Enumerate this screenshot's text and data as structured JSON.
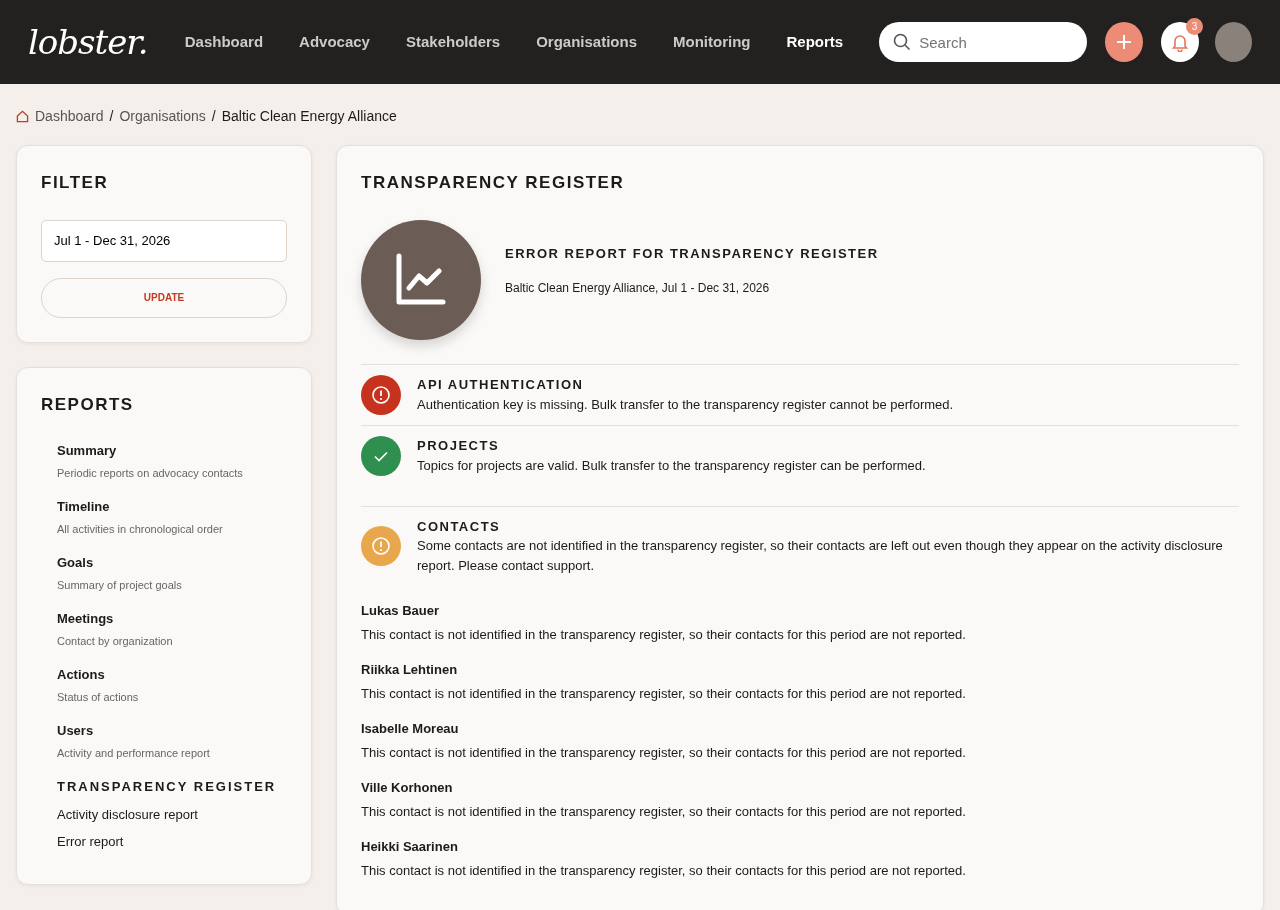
{
  "brand": "lobster.",
  "nav": [
    {
      "label": "Dashboard",
      "selected": false
    },
    {
      "label": "Advocacy",
      "selected": false
    },
    {
      "label": "Stakeholders",
      "selected": false
    },
    {
      "label": "Organisations",
      "selected": false
    },
    {
      "label": "Monitoring",
      "selected": false
    },
    {
      "label": "Reports",
      "selected": true
    }
  ],
  "search": {
    "placeholder": "Search"
  },
  "notifications": {
    "count": "3"
  },
  "breadcrumb": [
    "Dashboard",
    "Organisations",
    "Baltic Clean Energy Alliance"
  ],
  "breadcrumb_separator": "/",
  "filter": {
    "title": "FILTER",
    "date_range": "Jul 1 - Dec 31, 2026",
    "button": "UPDATE"
  },
  "reports": {
    "title": "REPORTS",
    "items": [
      {
        "title": "Summary",
        "subtitle": "Periodic reports on advocacy contacts"
      },
      {
        "title": "Timeline",
        "subtitle": "All activities in chronological order"
      },
      {
        "title": "Goals",
        "subtitle": "Summary of project goals"
      },
      {
        "title": "Meetings",
        "subtitle": "Contact by organization"
      },
      {
        "title": "Actions",
        "subtitle": "Status of actions"
      },
      {
        "title": "Users",
        "subtitle": "Activity and performance report"
      }
    ],
    "section": {
      "title": "TRANSPARENCY REGISTER",
      "links": [
        "Activity disclosure report",
        "Error report"
      ]
    }
  },
  "main": {
    "title": "TRANSPARENCY REGISTER",
    "report_title": "ERROR REPORT FOR TRANSPARENCY REGISTER",
    "report_subtitle": "Baltic Clean Energy Alliance, Jul 1 - Dec 31, 2026",
    "checks": [
      {
        "kind": "error",
        "title": "API AUTHENTICATION",
        "message": "Authentication key is missing. Bulk transfer to the transparency register cannot be performed."
      },
      {
        "kind": "ok",
        "title": "PROJECTS",
        "message": "Topics for projects are valid. Bulk transfer to the transparency register can be performed."
      },
      {
        "kind": "warning",
        "title": "CONTACTS",
        "message": "Some contacts are not identified in the transparency register, so their contacts are left out even though they appear on the activity disclosure report. Please contact support."
      }
    ],
    "contacts": [
      {
        "name": "Lukas Bauer",
        "message": "This contact is not identified in the transparency register, so their contacts for this period are not reported."
      },
      {
        "name": "Riikka Lehtinen",
        "message": "This contact is not identified in the transparency register, so their contacts for this period are not reported."
      },
      {
        "name": "Isabelle Moreau",
        "message": "This contact is not identified in the transparency register, so their contacts for this period are not reported."
      },
      {
        "name": "Ville Korhonen",
        "message": "This contact is not identified in the transparency register, so their contacts for this period are not reported."
      },
      {
        "name": "Heikki Saarinen",
        "message": "This contact is not identified in the transparency register, so their contacts for this period are not reported."
      }
    ]
  }
}
